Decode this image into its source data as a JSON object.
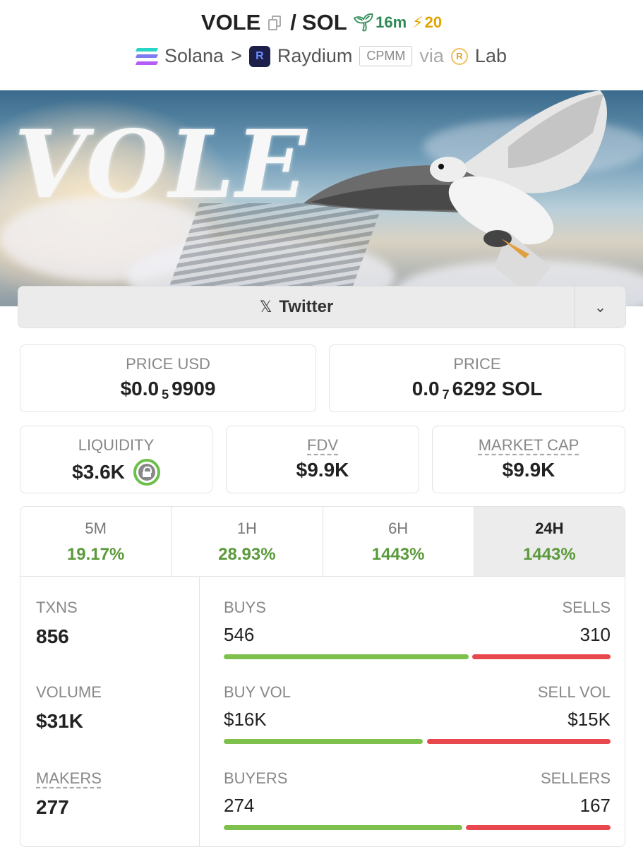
{
  "header": {
    "base_symbol": "VOLE",
    "separator": "/",
    "quote_symbol": "SOL",
    "age": "16m",
    "boosts": "20",
    "chain": "Solana",
    "chevron": ">",
    "dex": "Raydium",
    "pool_type": "CPMM",
    "via": "via",
    "launchpad": "Lab",
    "colors": {
      "age_green": "#2e8b57",
      "boost_gold": "#e0a500"
    }
  },
  "banner": {
    "word": "VOLE"
  },
  "socials": {
    "twitter_label": "Twitter",
    "twitter_glyph": "𝕏",
    "toggle_glyph": "⌄"
  },
  "prices": {
    "usd": {
      "label": "PRICE USD",
      "prefix": "$0.0",
      "zeros": "5",
      "digits": "9909"
    },
    "native": {
      "label": "PRICE",
      "prefix": "0.0",
      "zeros": "7",
      "digits": "6292 SOL"
    }
  },
  "metrics": {
    "liquidity": {
      "label": "LIQUIDITY",
      "value": "$3.6K"
    },
    "fdv": {
      "label": "FDV",
      "value": "$9.9K"
    },
    "market_cap": {
      "label": "MARKET CAP",
      "value": "$9.9K"
    }
  },
  "tabs": [
    {
      "label": "5M",
      "change": "19.17%"
    },
    {
      "label": "1H",
      "change": "28.93%"
    },
    {
      "label": "6H",
      "change": "1443%"
    },
    {
      "label": "24H",
      "change": "1443%",
      "active": true
    }
  ],
  "stats": {
    "txns": {
      "label": "TXNS",
      "value": "856"
    },
    "volume": {
      "label": "VOLUME",
      "value": "$31K"
    },
    "makers": {
      "label": "MAKERS",
      "value": "277"
    },
    "buys": {
      "label": "BUYS",
      "value": "546",
      "buy_fraction": 0.638
    },
    "sells": {
      "label": "SELLS",
      "value": "310"
    },
    "buy_vol": {
      "label": "BUY VOL",
      "value": "$16K",
      "buy_fraction": 0.52
    },
    "sell_vol": {
      "label": "SELL VOL",
      "value": "$15K"
    },
    "buyers": {
      "label": "BUYERS",
      "value": "274",
      "buy_fraction": 0.621
    },
    "sellers": {
      "label": "SELLERS",
      "value": "167"
    }
  },
  "colors": {
    "positive": "#5a9a3a",
    "buy_bar": "#7dc04b",
    "sell_bar": "#e8474d"
  }
}
